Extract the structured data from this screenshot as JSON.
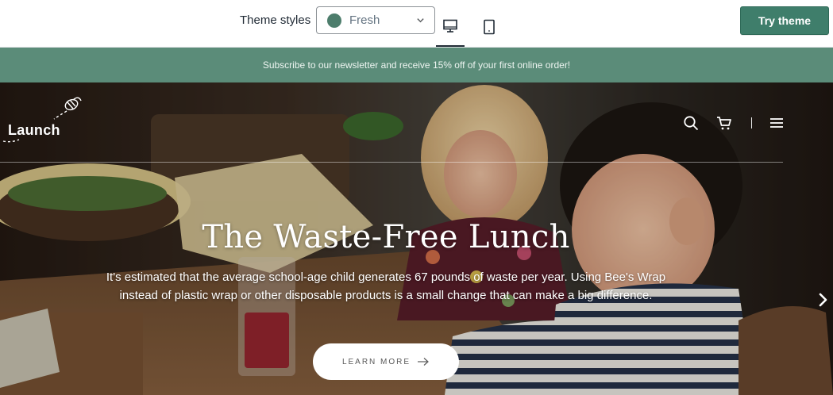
{
  "toolbar": {
    "theme_styles_label": "Theme styles",
    "selected_style": "Fresh",
    "selected_style_color": "#4d7d6c",
    "devices": [
      "desktop-icon",
      "tablet-icon"
    ],
    "active_device": "desktop",
    "try_button_label": "Try theme",
    "try_button_color": "#3f7e6b"
  },
  "announcement": {
    "text": "Subscribe to our newsletter and receive 15% off of your first online order!",
    "background": "#5b8c79"
  },
  "header": {
    "logo_text": "Launch",
    "logo_icon": "bee-icon",
    "icons": [
      "search-icon",
      "cart-icon",
      "menu-icon"
    ]
  },
  "hero": {
    "title": "The Waste-Free Lunch",
    "body": "It's estimated that the average school-age child generates 67 pounds of waste per year. Using Bee's Wrap instead of plastic wrap or other disposable products is a small change that can make a big difference.",
    "cta_label": "LEARN MORE",
    "cta_icon": "arrow-right-icon",
    "next_icon": "chevron-right-icon"
  }
}
